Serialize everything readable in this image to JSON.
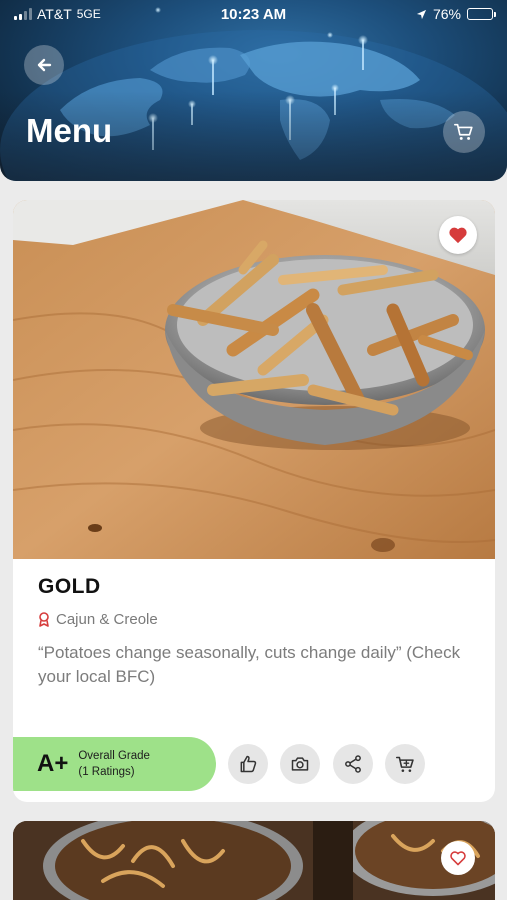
{
  "status_bar": {
    "carrier": "AT&T",
    "network": "5GE",
    "time": "10:23 AM",
    "battery": "76%",
    "battery_level": 0.76
  },
  "header": {
    "title": "Menu",
    "back_icon": "arrow-left-icon",
    "cart_icon": "shopping-cart-icon"
  },
  "item": {
    "name": "GOLD",
    "category": "Cajun & Creole",
    "category_icon": "award-ribbon-icon",
    "description": "“Potatoes change seasonally, cuts change daily” (Check your local BFC)",
    "favorited": true,
    "grade": "A+",
    "grade_label": "Overall Grade",
    "ratings_label": "(1 Ratings)",
    "actions": [
      "thumbs-up-icon",
      "camera-icon",
      "share-icon",
      "add-to-cart-icon"
    ]
  },
  "next_item": {
    "favorited": false
  },
  "colors": {
    "accent_red": "#d63c3c",
    "grade_green": "#9ee189",
    "background": "#ebebeb"
  }
}
